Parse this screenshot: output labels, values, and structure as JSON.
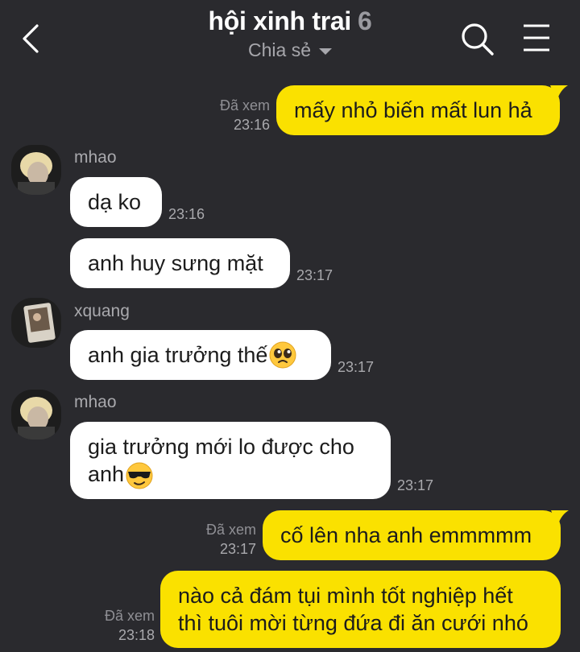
{
  "header": {
    "title": "hội xinh trai",
    "member_count": "6",
    "subtitle": "Chia sẻ"
  },
  "colors": {
    "background": "#2a2a2e",
    "my_bubble": "#fae100",
    "their_bubble": "#ffffff"
  },
  "messages": [
    {
      "id": "m1",
      "side": "mine",
      "text": "mấy nhỏ biến mất lun hả",
      "seen": "Đã xem",
      "time": "23:16"
    },
    {
      "id": "m2",
      "side": "theirs",
      "sender": "mhao",
      "text": "dạ ko",
      "time": "23:16"
    },
    {
      "id": "m3",
      "side": "theirs",
      "text": "anh huy sưng mặt",
      "time": "23:17"
    },
    {
      "id": "m4",
      "side": "theirs",
      "sender": "xquang",
      "text": "anh gia trưởng thế",
      "emoji": "pleading-face-emoji",
      "time": "23:17"
    },
    {
      "id": "m5",
      "side": "theirs",
      "sender": "mhao",
      "line1": "gia trưởng mới lo được cho",
      "line2": "anh",
      "emoji": "sunglasses-emoji",
      "time": "23:17"
    },
    {
      "id": "m6",
      "side": "mine",
      "text": "cố lên nha anh emmmmm",
      "seen": "Đã xem",
      "time": "23:17"
    },
    {
      "id": "m7",
      "side": "mine",
      "line1": "nào cả đám tụi mình tốt nghiệp hết",
      "line2": "thì tuôi mời từng đứa đi ăn cưới nhó",
      "seen": "Đã xem",
      "time": "23:18"
    }
  ]
}
